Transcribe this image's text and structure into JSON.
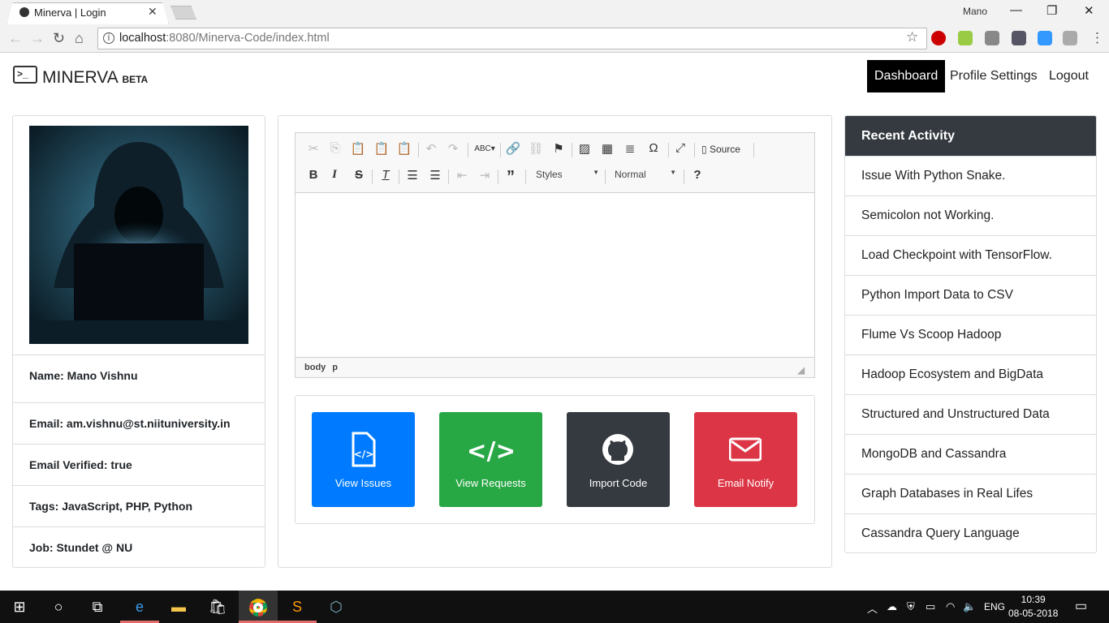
{
  "browser": {
    "tab_title": "Minerva | Login",
    "user": "Mano",
    "url_host": "localhost",
    "url_rest": ":8080/Minerva-Code/index.html"
  },
  "navbar": {
    "brand": "MINERVA",
    "badge": "BETA",
    "links": [
      "Dashboard",
      "Profile Settings",
      "Logout"
    ],
    "active": "Dashboard"
  },
  "profile": {
    "fields": [
      "Name: Mano Vishnu",
      "Email: am.vishnu@st.niituniversity.in",
      "Email Verified: true",
      "Tags: JavaScript, PHP, Python",
      "Job: Stundet @ NU"
    ]
  },
  "editor": {
    "source_label": "Source",
    "styles_label": "Styles",
    "format_label": "Normal",
    "path": [
      "body",
      "p"
    ],
    "content": ""
  },
  "actions": [
    {
      "label": "View Issues",
      "color": "#007bff",
      "icon": "file-code-icon"
    },
    {
      "label": "View Requests",
      "color": "#28a745",
      "icon": "code-icon"
    },
    {
      "label": "Import Code",
      "color": "#343a40",
      "icon": "github-icon"
    },
    {
      "label": "Email Notify",
      "color": "#dc3545",
      "icon": "envelope-icon"
    }
  ],
  "activity": {
    "title": "Recent Activity",
    "items": [
      "Issue With Python Snake.",
      "Semicolon not Working.",
      "Load Checkpoint with TensorFlow.",
      "Python Import Data to CSV",
      "Flume Vs Scoop Hadoop",
      "Hadoop Ecosystem and BigData",
      "Structured and Unstructured Data",
      "MongoDB and Cassandra",
      "Graph Databases in Real Lifes",
      "Cassandra Query Language"
    ]
  },
  "taskbar": {
    "lang": "ENG",
    "time": "10:39",
    "date": "08-05-2018"
  }
}
